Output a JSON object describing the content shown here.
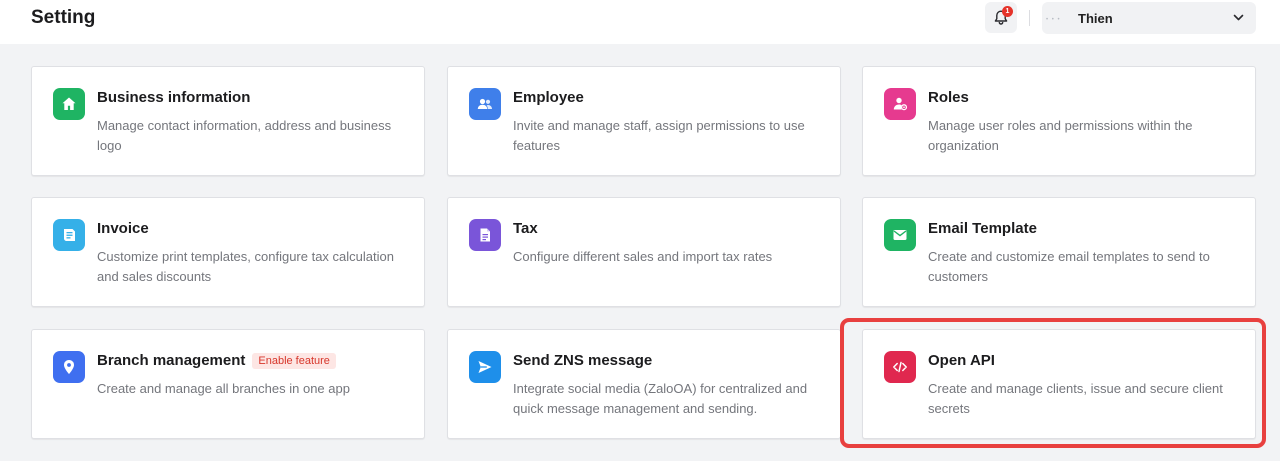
{
  "header": {
    "title": "Setting",
    "notification_count": "1",
    "user": {
      "placeholder_dots": "• • •",
      "name": "Thien"
    }
  },
  "colors": {
    "accent_highlight": "#e8403f",
    "badge_bg": "#fde6e4",
    "badge_text": "#d7372b"
  },
  "cards": [
    {
      "title": "Business information",
      "description": "Manage contact information, address and business logo",
      "icon": "home-icon",
      "icon_color": "#1fb463"
    },
    {
      "title": "Employee",
      "description": "Invite and manage staff, assign permissions to use features",
      "icon": "users-icon",
      "icon_color": "#3f7fea"
    },
    {
      "title": "Roles",
      "description": "Manage user roles and permissions within the organization",
      "icon": "user-role-icon",
      "icon_color": "#e63a8f"
    },
    {
      "title": "Invoice",
      "description": "Customize print templates, configure tax calculation and sales discounts",
      "icon": "invoice-icon",
      "icon_color": "#35b0e8"
    },
    {
      "title": "Tax",
      "description": "Configure different sales and import tax rates",
      "icon": "tax-document-icon",
      "icon_color": "#7a55d9"
    },
    {
      "title": "Email Template",
      "description": "Create and customize email templates to send to customers",
      "icon": "email-icon",
      "icon_color": "#1fb463"
    },
    {
      "title": "Branch management",
      "badge": "Enable feature",
      "description": "Create and manage all branches in one app",
      "icon": "location-pin-icon",
      "icon_color": "#3f6ff0"
    },
    {
      "title": "Send ZNS message",
      "description": "Integrate social media (ZaloOA) for centralized and quick message management and sending.",
      "icon": "send-icon",
      "icon_color": "#1e8fea"
    },
    {
      "title": "Open API",
      "description": "Create and manage clients, issue and secure client secrets",
      "icon": "code-icon",
      "icon_color": "#e0284f"
    }
  ]
}
